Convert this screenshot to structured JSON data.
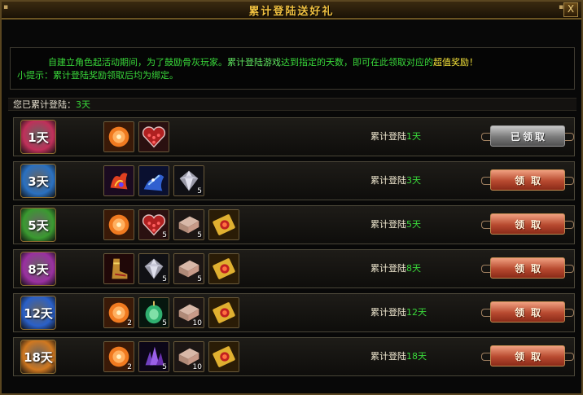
{
  "window": {
    "title": "累计登陆送好礼",
    "close_label": "X"
  },
  "notice": {
    "line1_a": "自建立角色起活动期间，为了鼓励骨灰玩家。",
    "line1_b": "累计登陆游戏",
    "line1_c": "达到指定的天数，即可在此领取对应的",
    "line1_d": "超值奖励",
    "line1_e": "！",
    "line2": "小提示：累计登陆奖励领取后均为绑定。"
  },
  "total": {
    "label": "您已累计登陆：",
    "days": "3天"
  },
  "rows": [
    {
      "badge": "1天",
      "badge_color": "#c0305a",
      "cond_label": "累计登陆",
      "cond_days": "1天",
      "button": "已领取",
      "claimed": true,
      "items": [
        {
          "icon": "orange-orb-icon",
          "count": ""
        },
        {
          "icon": "heart-gems-icon",
          "count": ""
        }
      ]
    },
    {
      "badge": "3天",
      "badge_color": "#2a70c0",
      "cond_label": "累计登陆",
      "cond_days": "3天",
      "button": "领取",
      "claimed": false,
      "items": [
        {
          "icon": "fire-wings-icon",
          "count": ""
        },
        {
          "icon": "blue-spirit-icon",
          "count": ""
        },
        {
          "icon": "silver-diamond-icon",
          "count": "5"
        }
      ]
    },
    {
      "badge": "5天",
      "badge_color": "#3a9a30",
      "cond_label": "累计登陆",
      "cond_days": "5天",
      "button": "领取",
      "claimed": false,
      "items": [
        {
          "icon": "orange-orb-icon",
          "count": ""
        },
        {
          "icon": "heart-gems-icon",
          "count": "5"
        },
        {
          "icon": "stone-block-icon",
          "count": "5"
        },
        {
          "icon": "gold-scroll-icon",
          "count": ""
        }
      ]
    },
    {
      "badge": "8天",
      "badge_color": "#9a30a0",
      "cond_label": "累计登陆",
      "cond_days": "8天",
      "button": "领取",
      "claimed": false,
      "items": [
        {
          "icon": "golden-boots-icon",
          "count": ""
        },
        {
          "icon": "silver-diamond-icon",
          "count": "5"
        },
        {
          "icon": "stone-block-icon",
          "count": "5"
        },
        {
          "icon": "gold-scroll-icon",
          "count": ""
        }
      ]
    },
    {
      "badge": "12天",
      "badge_color": "#2a60c8",
      "cond_label": "累计登陆",
      "cond_days": "12天",
      "button": "领取",
      "claimed": false,
      "items": [
        {
          "icon": "orange-orb-icon",
          "count": "2"
        },
        {
          "icon": "jade-pendant-icon",
          "count": "5"
        },
        {
          "icon": "stone-block-icon",
          "count": "10"
        },
        {
          "icon": "gold-scroll-icon",
          "count": ""
        }
      ]
    },
    {
      "badge": "18天",
      "badge_color": "#d07820",
      "cond_label": "累计登陆",
      "cond_days": "18天",
      "button": "领取",
      "claimed": false,
      "items": [
        {
          "icon": "orange-orb-icon",
          "count": "2"
        },
        {
          "icon": "purple-crystal-icon",
          "count": "5"
        },
        {
          "icon": "stone-block-icon",
          "count": "10"
        },
        {
          "icon": "gold-scroll-icon",
          "count": ""
        }
      ]
    }
  ]
}
